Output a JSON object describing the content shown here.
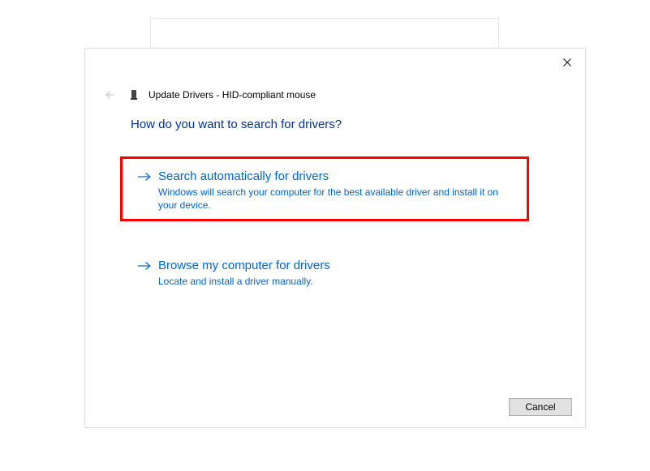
{
  "dialog": {
    "title": "Update Drivers - HID-compliant mouse",
    "heading": "How do you want to search for drivers?",
    "options": {
      "auto": {
        "title": "Search automatically for drivers",
        "desc": "Windows will search your computer for the best available driver and install it on your device."
      },
      "browse": {
        "title": "Browse my computer for drivers",
        "desc": "Locate and install a driver manually."
      }
    },
    "cancel": "Cancel"
  }
}
